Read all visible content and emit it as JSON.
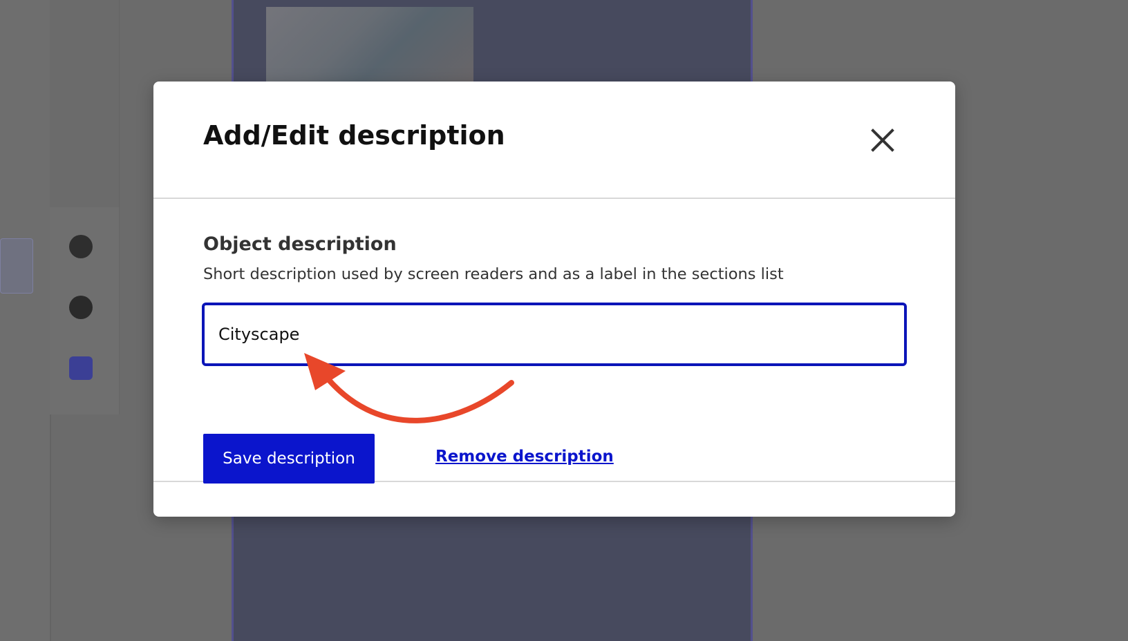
{
  "dialog": {
    "title": "Add/Edit description",
    "close_icon": "close-icon",
    "field": {
      "label": "Object description",
      "hint": "Short description used by screen readers and as a label in the sections list",
      "value": "Cityscape"
    },
    "actions": {
      "save_label": "Save description",
      "remove_label": "Remove description"
    }
  },
  "annotation": {
    "arrow_icon": "curved-arrow-icon",
    "color": "#e8472a"
  },
  "colors": {
    "accent": "#0b15cc",
    "overlay": "#6b6b6b",
    "canvas": "#474a5e"
  }
}
